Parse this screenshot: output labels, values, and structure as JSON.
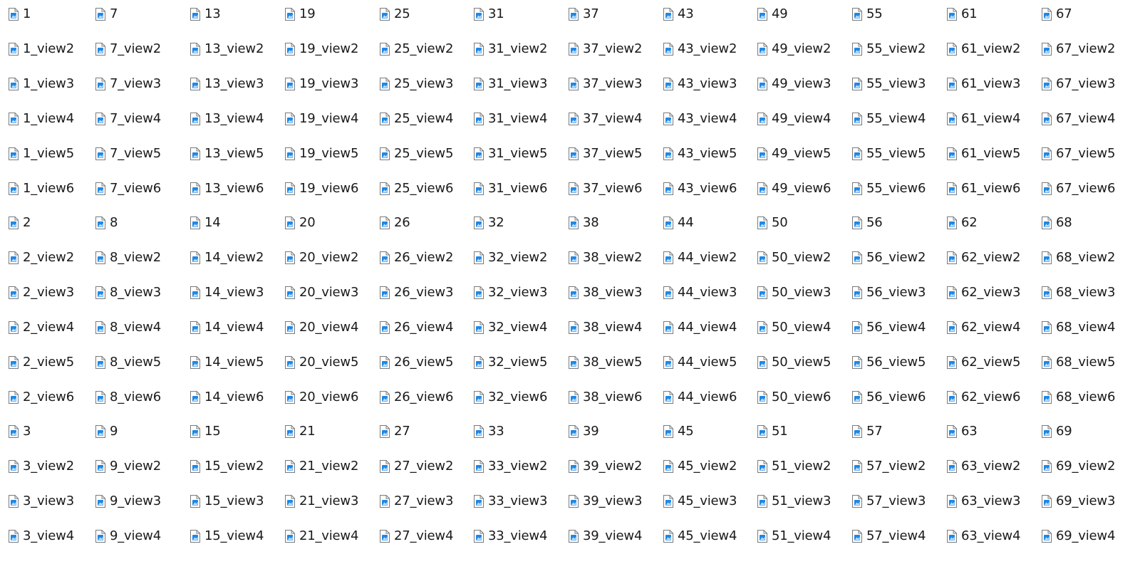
{
  "icon": {
    "name": "image-file-icon",
    "outline_color": "#7a7a7a",
    "picture_color": "#1e88e5"
  },
  "columns": [
    {
      "items": [
        "1",
        "1_view2",
        "1_view3",
        "1_view4",
        "1_view5",
        "1_view6",
        "2",
        "2_view2",
        "2_view3",
        "2_view4",
        "2_view5",
        "2_view6",
        "3",
        "3_view2",
        "3_view3",
        "3_view4"
      ]
    },
    {
      "items": [
        "7",
        "7_view2",
        "7_view3",
        "7_view4",
        "7_view5",
        "7_view6",
        "8",
        "8_view2",
        "8_view3",
        "8_view4",
        "8_view5",
        "8_view6",
        "9",
        "9_view2",
        "9_view3",
        "9_view4"
      ]
    },
    {
      "items": [
        "13",
        "13_view2",
        "13_view3",
        "13_view4",
        "13_view5",
        "13_view6",
        "14",
        "14_view2",
        "14_view3",
        "14_view4",
        "14_view5",
        "14_view6",
        "15",
        "15_view2",
        "15_view3",
        "15_view4"
      ]
    },
    {
      "items": [
        "19",
        "19_view2",
        "19_view3",
        "19_view4",
        "19_view5",
        "19_view6",
        "20",
        "20_view2",
        "20_view3",
        "20_view4",
        "20_view5",
        "20_view6",
        "21",
        "21_view2",
        "21_view3",
        "21_view4"
      ]
    },
    {
      "items": [
        "25",
        "25_view2",
        "25_view3",
        "25_view4",
        "25_view5",
        "25_view6",
        "26",
        "26_view2",
        "26_view3",
        "26_view4",
        "26_view5",
        "26_view6",
        "27",
        "27_view2",
        "27_view3",
        "27_view4"
      ]
    },
    {
      "items": [
        "31",
        "31_view2",
        "31_view3",
        "31_view4",
        "31_view5",
        "31_view6",
        "32",
        "32_view2",
        "32_view3",
        "32_view4",
        "32_view5",
        "32_view6",
        "33",
        "33_view2",
        "33_view3",
        "33_view4"
      ]
    },
    {
      "items": [
        "37",
        "37_view2",
        "37_view3",
        "37_view4",
        "37_view5",
        "37_view6",
        "38",
        "38_view2",
        "38_view3",
        "38_view4",
        "38_view5",
        "38_view6",
        "39",
        "39_view2",
        "39_view3",
        "39_view4"
      ]
    },
    {
      "items": [
        "43",
        "43_view2",
        "43_view3",
        "43_view4",
        "43_view5",
        "43_view6",
        "44",
        "44_view2",
        "44_view3",
        "44_view4",
        "44_view5",
        "44_view6",
        "45",
        "45_view2",
        "45_view3",
        "45_view4"
      ]
    },
    {
      "items": [
        "49",
        "49_view2",
        "49_view3",
        "49_view4",
        "49_view5",
        "49_view6",
        "50",
        "50_view2",
        "50_view3",
        "50_view4",
        "50_view5",
        "50_view6",
        "51",
        "51_view2",
        "51_view3",
        "51_view4"
      ]
    },
    {
      "items": [
        "55",
        "55_view2",
        "55_view3",
        "55_view4",
        "55_view5",
        "55_view6",
        "56",
        "56_view2",
        "56_view3",
        "56_view4",
        "56_view5",
        "56_view6",
        "57",
        "57_view2",
        "57_view3",
        "57_view4"
      ]
    },
    {
      "items": [
        "61",
        "61_view2",
        "61_view3",
        "61_view4",
        "61_view5",
        "61_view6",
        "62",
        "62_view2",
        "62_view3",
        "62_view4",
        "62_view5",
        "62_view6",
        "63",
        "63_view2",
        "63_view3",
        "63_view4"
      ]
    },
    {
      "items": [
        "67",
        "67_view2",
        "67_view3",
        "67_view4",
        "67_view5",
        "67_view6",
        "68",
        "68_view2",
        "68_view3",
        "68_view4",
        "68_view5",
        "68_view6",
        "69",
        "69_view2",
        "69_view3",
        "69_view4"
      ]
    }
  ]
}
